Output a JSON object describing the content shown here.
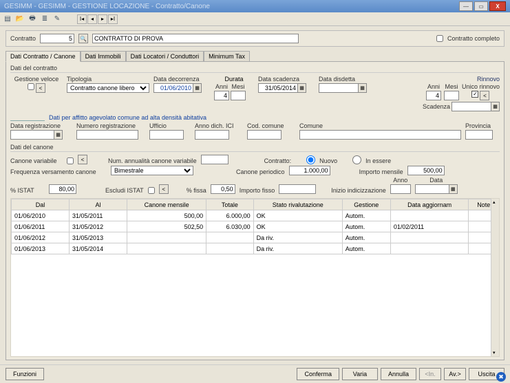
{
  "window": {
    "title": "GESIMM - GESIMM - GESTIONE LOCAZIONE - Contratto/Canone",
    "watermark": ""
  },
  "contratto": {
    "label": "Contratto",
    "num": "5",
    "desc": "CONTRATTO DI PROVA",
    "completo_label": "Contratto completo"
  },
  "tabs": [
    "Dati Contratto / Canone",
    "Dati Immobili",
    "Dati Locatori / Conduttori",
    "Minimum Tax"
  ],
  "sec1": {
    "title": "Dati del contratto",
    "gestione_veloce": "Gestione veloce",
    "lt": "<",
    "tipologia_label": "Tipologia",
    "tipologia_val": "Contratto canone libero",
    "decorrenza_label": "Data decorrenza",
    "decorrenza": "01/06/2010",
    "durata": "Durata",
    "anni": "Anni",
    "mesi": "Mesi",
    "anni_val": "4",
    "mesi_val": "",
    "scadenza_label": "Data scadenza",
    "scadenza": "31/05/2014",
    "disdetta_label": "Data disdetta",
    "disdetta": "",
    "rinnovo": "Rinnovo",
    "r_anni": "Anni",
    "r_mesi": "Mesi",
    "r_anni_val": "4",
    "r_mesi_val": "",
    "unico_rinnovo": "Unico rinnovo",
    "scadenza2": "Scadenza"
  },
  "sec2": {
    "link": "Dati per affitto agevolato comune ad alta densità abitativa",
    "reg_label": "Data registrazione",
    "numreg_label": "Numero registrazione",
    "ufficio_label": "Ufficio",
    "annoici_label": "Anno dich. ICI",
    "codcom_label": "Cod. comune",
    "comune_label": "Comune",
    "prov_label": "Provincia"
  },
  "sec3": {
    "title": "Dati del canone",
    "canone_var": "Canone variabile",
    "lt": "<",
    "num_annual": "Num. annualità canone variabile",
    "contratto": "Contratto:",
    "nuovo": "Nuovo",
    "inessere": "In essere",
    "freq_label": "Frequenza versamento canone",
    "freq_val": "Bimestrale",
    "periodico_label": "Canone periodico",
    "periodico_val": "1.000,00",
    "mensile_label": "Importo mensile",
    "mensile_val": "500,00",
    "istat_label": "% ISTAT",
    "istat_val": "80,00",
    "escludi_label": "Escludi ISTAT",
    "fissa_label": "% fissa",
    "fissa_val": "0,50",
    "fisso_label": "Importo fisso",
    "fisso_val": "",
    "inizio_label": "Inizio indicizzazione",
    "anno_l": "Anno",
    "data_l": "Data"
  },
  "table": {
    "headers": [
      "Dal",
      "Al",
      "Canone mensile",
      "Totale",
      "Stato rivalutazione",
      "Gestione",
      "Data aggiornam",
      "Note"
    ],
    "rows": [
      {
        "dal": "01/06/2010",
        "al": "31/05/2011",
        "cm": "500,00",
        "tot": "6.000,00",
        "stato": "OK",
        "gest": "Autom.",
        "dataagg": "",
        "note": ""
      },
      {
        "dal": "01/06/2011",
        "al": "31/05/2012",
        "cm": "502,50",
        "tot": "6.030,00",
        "stato": "OK",
        "gest": "Autom.",
        "dataagg": "01/02/2011",
        "note": ""
      },
      {
        "dal": "01/06/2012",
        "al": "31/05/2013",
        "cm": "",
        "tot": "",
        "stato": "Da riv.",
        "gest": "Autom.",
        "dataagg": "",
        "note": ""
      },
      {
        "dal": "01/06/2013",
        "al": "31/05/2014",
        "cm": "",
        "tot": "",
        "stato": "Da riv.",
        "gest": "Autom.",
        "dataagg": "",
        "note": ""
      }
    ]
  },
  "buttons": {
    "funzioni": "Funzioni",
    "conferma": "Conferma",
    "varia": "Varia",
    "annulla": "Annulla",
    "prev": "<In.",
    "next": "Av.>",
    "uscita": "Uscita"
  }
}
